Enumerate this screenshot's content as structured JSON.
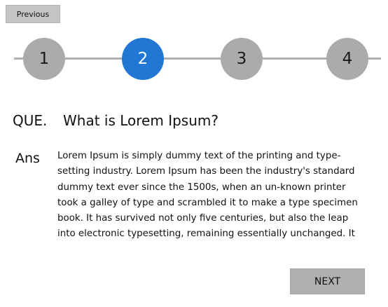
{
  "nav": {
    "previous_label": "Previous",
    "next_label": "NEXT"
  },
  "stepper": {
    "active_step": 2,
    "steps": [
      {
        "label": "1"
      },
      {
        "label": "2"
      },
      {
        "label": "3"
      },
      {
        "label": "4"
      }
    ]
  },
  "question": {
    "prefix": "QUE.",
    "text": "What is Lorem Ipsum?"
  },
  "answer": {
    "prefix": "Ans",
    "text": "Lorem Ipsum is simply dummy text of the printing and type-setting industry. Lorem Ipsum has been the industry's standard dummy text ever since the 1500s, when an un-known printer took a galley of type and scrambled it to make a type specimen book. It has survived not only five centuries, but also the leap into electronic typesetting, remaining essentially unchanged. It"
  },
  "colors": {
    "active_step": "#2178d4",
    "inactive_step": "#ababab",
    "button_bg": "#c4c4c4"
  }
}
